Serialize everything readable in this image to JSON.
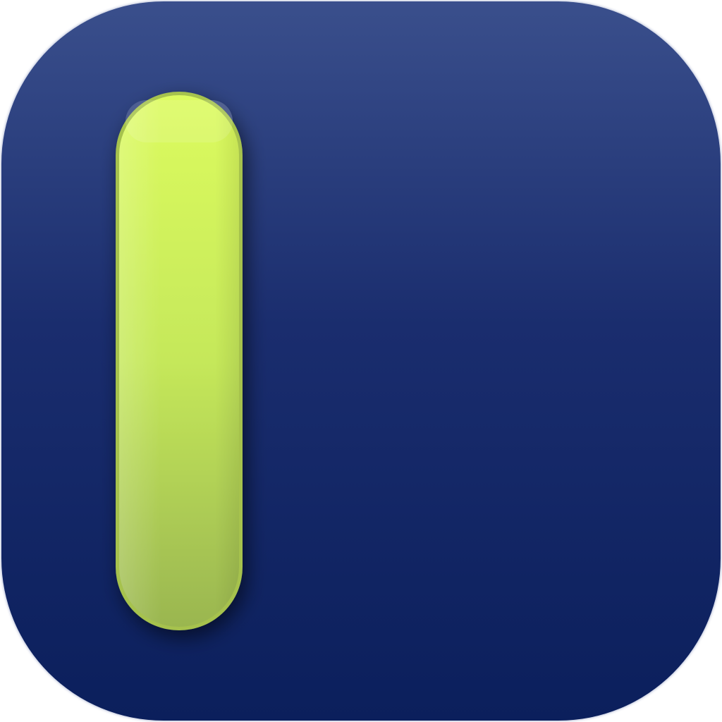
{
  "icon": {
    "name": "app-icon",
    "colors": {
      "background_top": "#3a4f8c",
      "background_mid": "#1a2d6e",
      "background_bottom": "#0b1f5c",
      "bar_top": "#dcfb5e",
      "bar_bottom": "#9ab650",
      "bar_edge": "#a6c24e"
    }
  }
}
